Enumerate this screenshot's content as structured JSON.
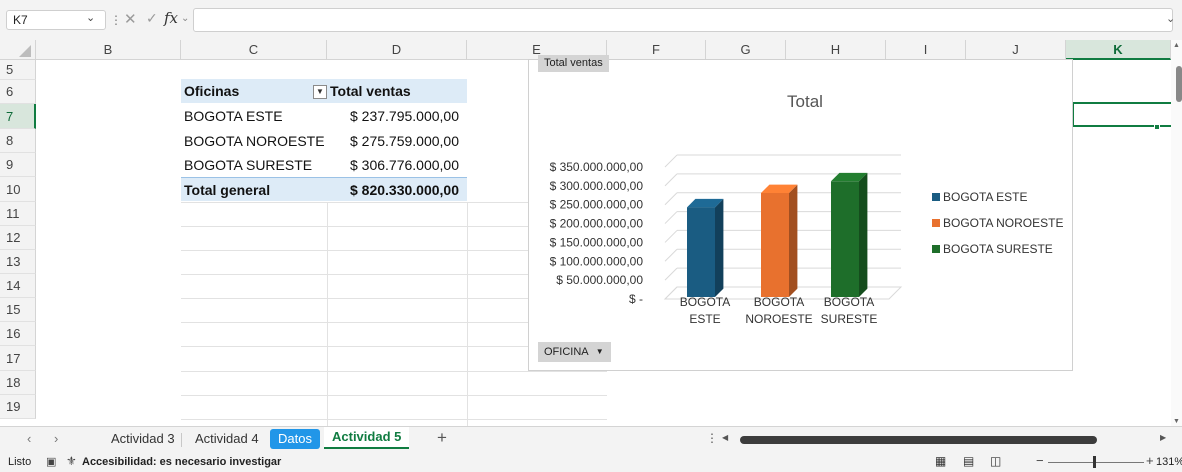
{
  "formula_bar": {
    "name_box": "K7",
    "formula": "",
    "fx_label": "fx"
  },
  "columns": [
    "B",
    "C",
    "D",
    "E",
    "F",
    "G",
    "H",
    "I",
    "J",
    "K"
  ],
  "rows": [
    "5",
    "6",
    "7",
    "8",
    "9",
    "10",
    "11",
    "12",
    "13",
    "14",
    "15",
    "16",
    "17",
    "18",
    "19"
  ],
  "pivot": {
    "header_office": "Oficinas",
    "header_total": "Total ventas",
    "rows": [
      {
        "office": "BOGOTA ESTE",
        "total": "$ 237.795.000,00"
      },
      {
        "office": "BOGOTA NOROESTE",
        "total": "$ 275.759.000,00"
      },
      {
        "office": "BOGOTA SURESTE",
        "total": "$ 306.776.000,00"
      }
    ],
    "grand_total_label": "Total general",
    "grand_total_value": "$ 820.330.000,00"
  },
  "chart_field_value_button": "Total ventas",
  "chart_field_axis_button": "OFICINA",
  "chart_data": {
    "type": "bar",
    "title": "Total",
    "categories": [
      "BOGOTA ESTE",
      "BOGOTA NOROESTE",
      "BOGOTA SURESTE"
    ],
    "category_lines": [
      [
        "BOGOTA",
        "ESTE"
      ],
      [
        "BOGOTA",
        "NOROESTE"
      ],
      [
        "BOGOTA",
        "SURESTE"
      ]
    ],
    "values": [
      237795000,
      275759000,
      306776000
    ],
    "colors": [
      "#1a5c82",
      "#e8712e",
      "#1e6e2a"
    ],
    "ylim": [
      0,
      350000000
    ],
    "yticks": [
      "$ -",
      "$ 50.000.000,00",
      "$ 100.000.000,00",
      "$ 150.000.000,00",
      "$ 200.000.000,00",
      "$ 250.000.000,00",
      "$ 300.000.000,00",
      "$ 350.000.000,00"
    ],
    "legend": [
      "BOGOTA ESTE",
      "BOGOTA NOROESTE",
      "BOGOTA SURESTE"
    ],
    "legend_position": "right",
    "grid": true,
    "style": "3d"
  },
  "sheet_tabs": [
    {
      "label": "Actividad 3"
    },
    {
      "label": "Actividad 4"
    },
    {
      "label": "Datos"
    },
    {
      "label": "Actividad 5"
    }
  ],
  "status_bar": {
    "ready": "Listo",
    "accessibility": "Accesibilidad: es necesario investigar",
    "zoom": "131%"
  }
}
